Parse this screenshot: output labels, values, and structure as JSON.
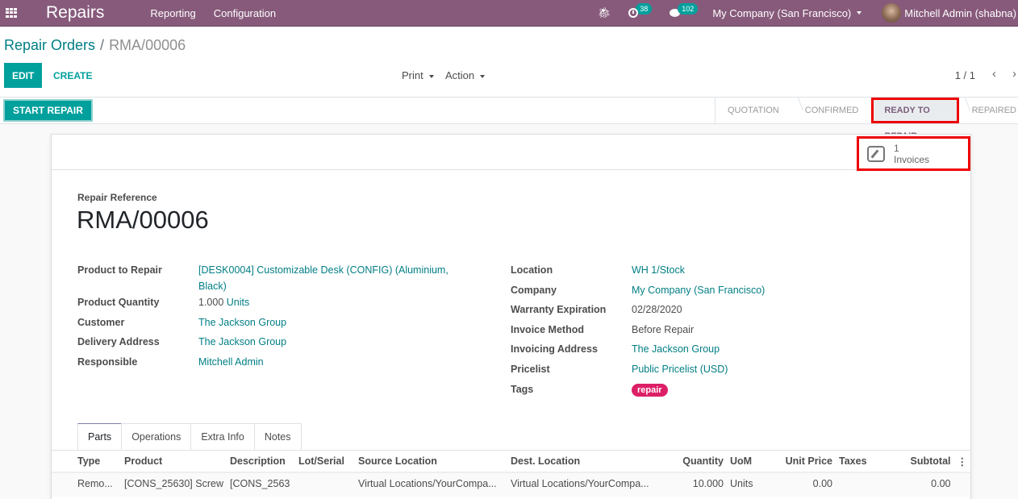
{
  "navbar": {
    "app_title": "Repairs",
    "menu": [
      "Reporting",
      "Configuration"
    ],
    "activity_count": "38",
    "messages_count": "102",
    "company": "My Company (San Francisco)",
    "user": "Mitchell Admin (shabna)"
  },
  "control_panel": {
    "breadcrumb_parent": "Repair Orders",
    "breadcrumb_separator": "/",
    "breadcrumb_current": "RMA/00006",
    "edit_label": "EDIT",
    "create_label": "CREATE",
    "print_label": "Print",
    "action_label": "Action",
    "pager": "1 / 1"
  },
  "statusbar": {
    "start_repair_label": "START REPAIR",
    "stages": [
      {
        "label": "QUOTATION",
        "active": false
      },
      {
        "label": "CONFIRMED",
        "active": false
      },
      {
        "label": "READY TO REPAIR",
        "active": true
      },
      {
        "label": "REPAIRED",
        "active": false
      }
    ]
  },
  "smart_button": {
    "count": "1",
    "label": "Invoices"
  },
  "form": {
    "reference_label": "Repair Reference",
    "reference": "RMA/00006",
    "left": [
      {
        "label": "Product to Repair",
        "value": "[DESK0004] Customizable Desk (CONFIG) (Aluminium, Black)"
      },
      {
        "label": "Product Quantity",
        "value": "1.000",
        "unit": "Units"
      },
      {
        "label": "Customer",
        "value": "The Jackson Group"
      },
      {
        "label": "Delivery Address",
        "value": "The Jackson Group"
      },
      {
        "label": "Responsible",
        "value": "Mitchell Admin"
      }
    ],
    "right": [
      {
        "label": "Location",
        "value": "WH 1/Stock"
      },
      {
        "label": "Company",
        "value": "My Company (San Francisco)"
      },
      {
        "label": "Warranty Expiration",
        "value": "02/28/2020"
      },
      {
        "label": "Invoice Method",
        "value": "Before Repair"
      },
      {
        "label": "Invoicing Address",
        "value": "The Jackson Group"
      },
      {
        "label": "Pricelist",
        "value": "Public Pricelist (USD)"
      },
      {
        "label": "Tags",
        "value": "repair"
      }
    ]
  },
  "notebook": {
    "tabs": [
      "Parts",
      "Operations",
      "Extra Info",
      "Notes"
    ],
    "active_tab": "Parts",
    "columns": [
      "Type",
      "Product",
      "Description",
      "Lot/Serial",
      "Source Location",
      "Dest. Location",
      "Quantity",
      "UoM",
      "Unit Price",
      "Taxes",
      "Subtotal"
    ],
    "rows": [
      {
        "type": "Remo...",
        "product": "[CONS_25630] Screw",
        "description": "[CONS_2563",
        "lot": "",
        "source": "Virtual Locations/YourCompa...",
        "dest": "Virtual Locations/YourCompa...",
        "quantity": "10.000",
        "uom": "Units",
        "unit_price": "0.00",
        "taxes": "",
        "subtotal": "0.00"
      }
    ]
  },
  "colors": {
    "navbar": "#875a7b",
    "primary": "#00a09d",
    "link": "#017e84",
    "tag": "#dc1f66",
    "highlight": "#ee0000"
  }
}
